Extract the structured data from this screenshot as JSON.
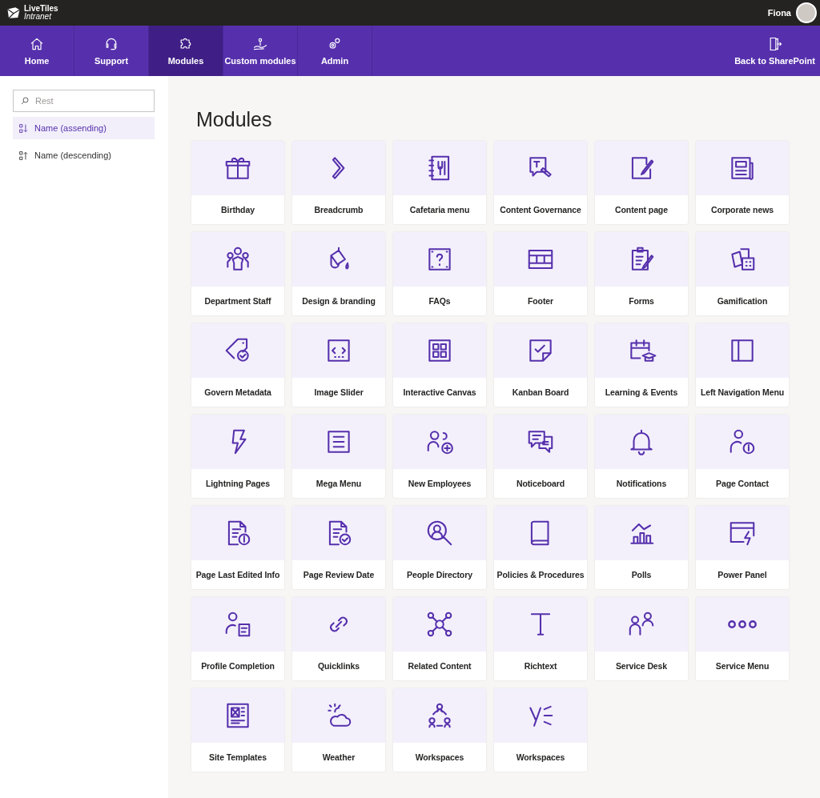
{
  "brand": {
    "line1": "LiveTiles",
    "line2": "Intranet"
  },
  "user": {
    "name": "Fiona"
  },
  "nav": [
    {
      "label": "Home",
      "selected": false
    },
    {
      "label": "Support",
      "selected": false
    },
    {
      "label": "Modules",
      "selected": true
    },
    {
      "label": "Custom modules",
      "selected": false
    },
    {
      "label": "Admin",
      "selected": false
    }
  ],
  "back_link": "Back to SharePoint",
  "sidebar": {
    "search": {
      "placeholder": "Rest"
    },
    "sort_options": [
      {
        "label": "Name (assending)",
        "selected": true
      },
      {
        "label": "Name (descending)",
        "selected": false
      }
    ]
  },
  "title": "Modules",
  "modules": [
    "Birthday",
    "Breadcrumb",
    "Cafetaria menu",
    "Content Governance",
    "Content page",
    "Corporate news",
    "Department Staff",
    "Design & branding",
    "FAQs",
    "Footer",
    "Forms",
    "Gamification",
    "Govern Metadata",
    "Image Slider",
    "Interactive Canvas",
    "Kanban Board",
    "Learning & Events",
    "Left Navigation Menu",
    "Lightning Pages",
    "Mega Menu",
    "New Employees",
    "Noticeboard",
    "Notifications",
    "Page Contact",
    "Page Last Edited Info",
    "Page Review Date",
    "People Directory",
    "Policies & Procedures",
    "Polls",
    "Power Panel",
    "Profile Completion",
    "Quicklinks",
    "Related Content",
    "Richtext",
    "Service Desk",
    "Service Menu",
    "Site Templates",
    "Weather",
    "Workspaces",
    "Workspaces"
  ]
}
